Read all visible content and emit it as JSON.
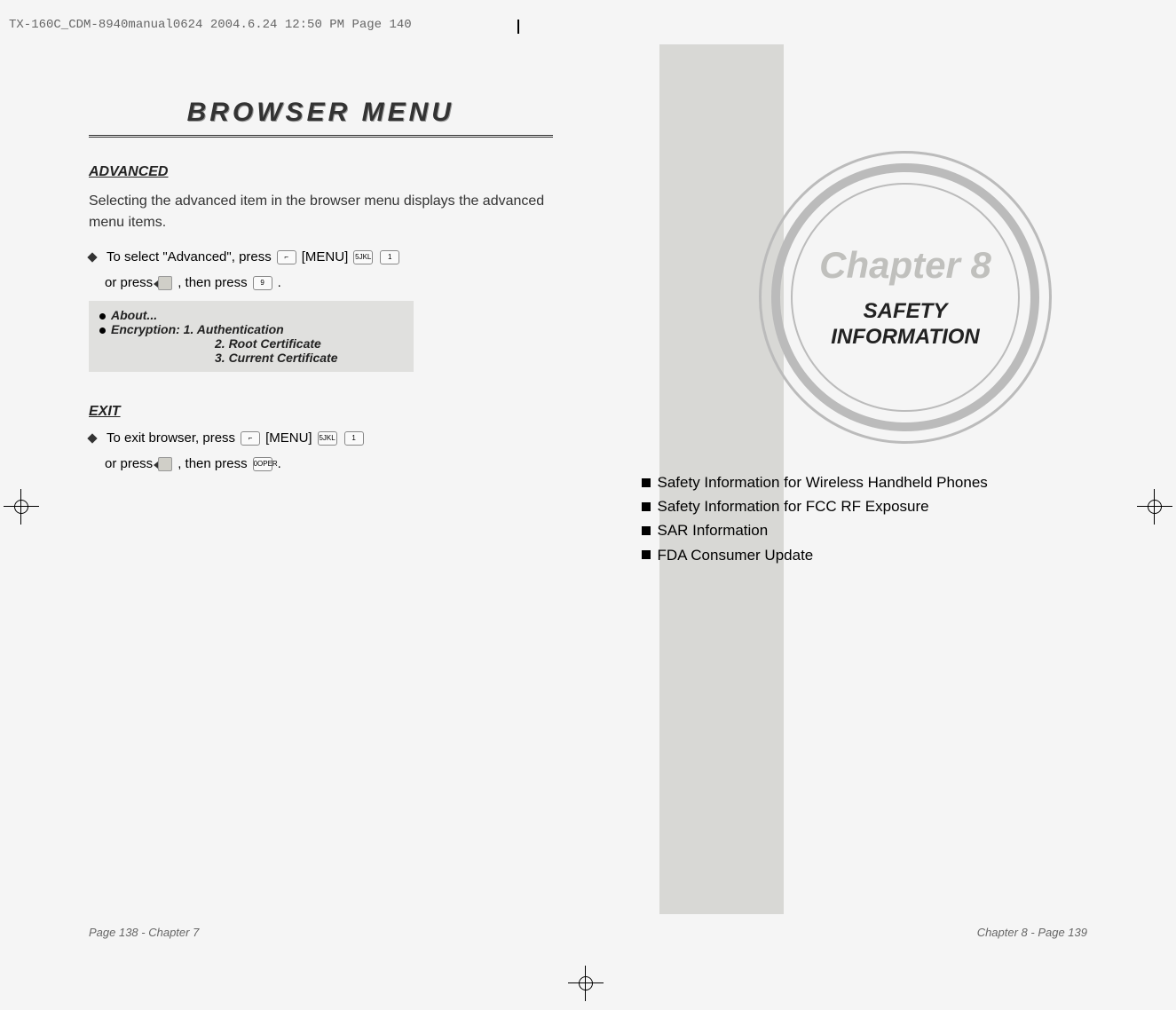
{
  "header": {
    "file_info": "TX-160C_CDM-8940manual0624  2004.6.24  12:50 PM  Page 140"
  },
  "left_page": {
    "title": "BROWSER MENU",
    "advanced": {
      "heading": "ADVANCED",
      "description": "Selecting the advanced item in the browser menu displays the advanced menu items.",
      "step_prefix": "To select \"Advanced\", press",
      "menu_label": "[MENU]",
      "or_press": "or press",
      "then_press": ", then press",
      "period": ".",
      "box": {
        "line1": "About...",
        "line2_label": "Encryption:",
        "line2_1": "1. Authentication",
        "line2_2": "2. Root Certificate",
        "line2_3": "3. Current Certificate"
      }
    },
    "exit": {
      "heading": "EXIT",
      "step_prefix": "To exit browser, press",
      "menu_label": "[MENU]",
      "or_press": "or press",
      "then_press": ", then press",
      "period": "."
    },
    "footer": "Page 138 - Chapter 7"
  },
  "right_page": {
    "chapter_title": "Chapter 8",
    "chapter_sub1": "SAFETY",
    "chapter_sub2": "INFORMATION",
    "bullets": {
      "b1": "Safety Information for Wireless Handheld Phones",
      "b2": "Safety Information for FCC RF Exposure",
      "b3": "SAR Information",
      "b4": "FDA Consumer Update"
    },
    "footer": "Chapter 8 - Page 139"
  },
  "keys": {
    "five": "5JKL",
    "one": "1",
    "nine": "9",
    "zero": "0OPER"
  }
}
